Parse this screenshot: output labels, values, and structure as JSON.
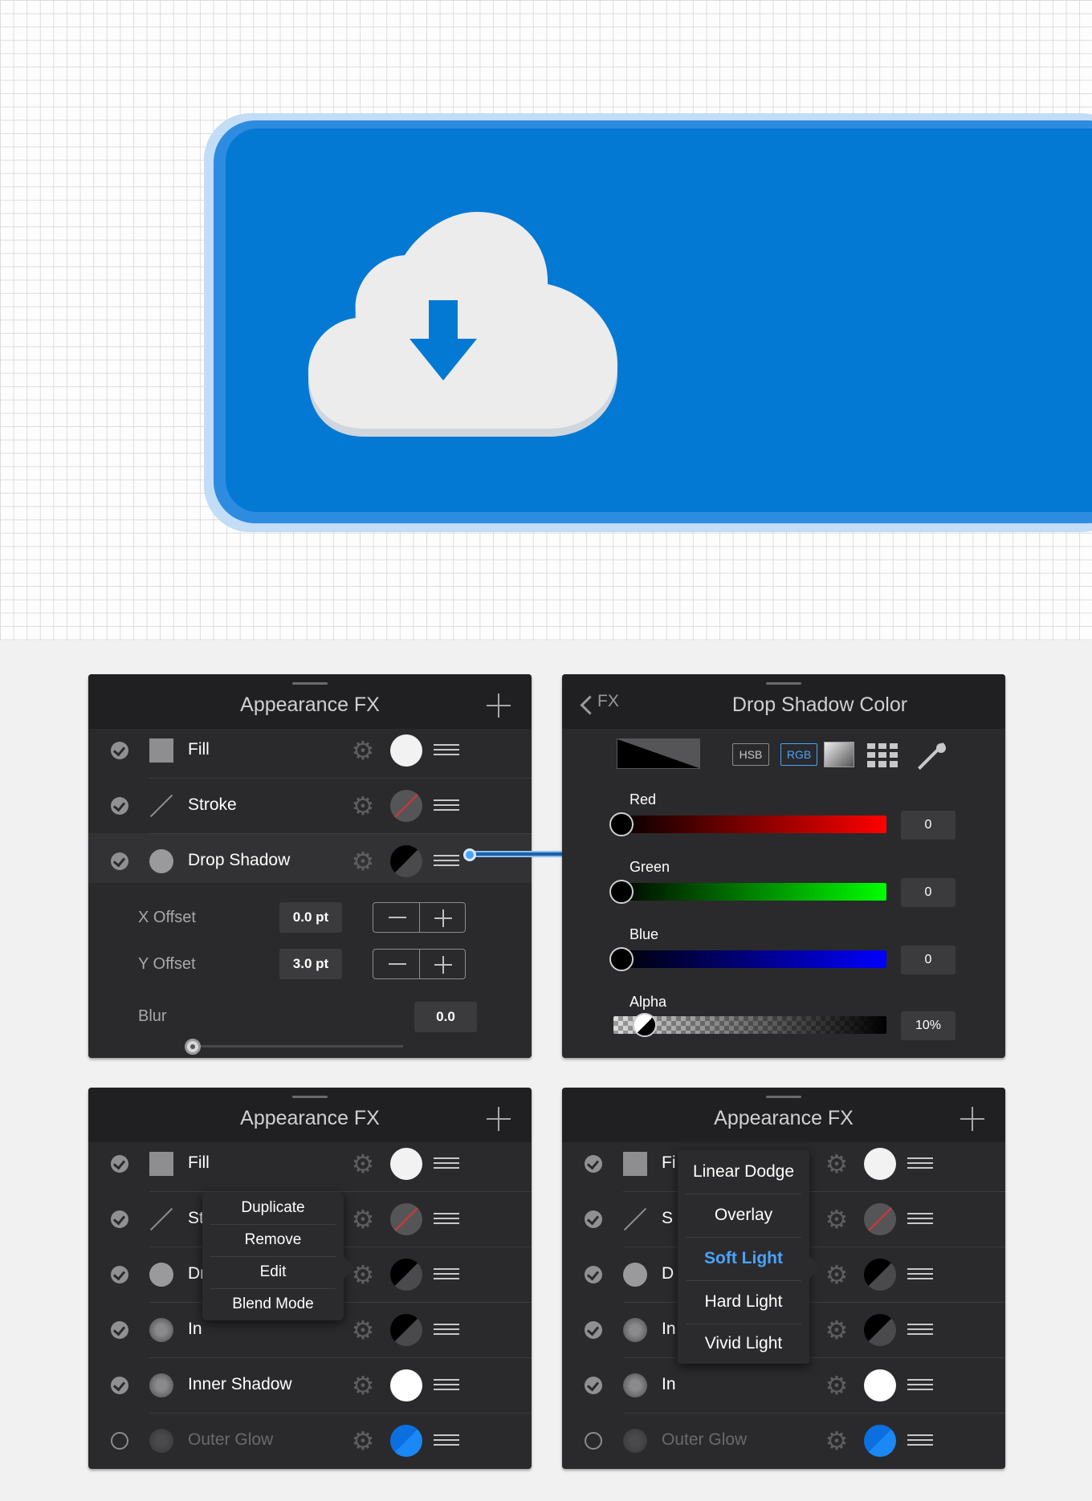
{
  "canvas": {
    "button_color": "#0479d4",
    "icon": "cloud-download-icon"
  },
  "fx_panel_1": {
    "title": "Appearance FX",
    "rows": [
      {
        "label": "Fill"
      },
      {
        "label": "Stroke"
      },
      {
        "label": "Drop Shadow"
      }
    ],
    "props": {
      "x_offset_label": "X Offset",
      "x_offset_value": "0.0 pt",
      "y_offset_label": "Y Offset",
      "y_offset_value": "3.0 pt",
      "blur_label": "Blur",
      "blur_value": "0.0"
    }
  },
  "color_panel": {
    "back_label": "FX",
    "title": "Drop Shadow Color",
    "hsb": "HSB",
    "rgb": "RGB",
    "red_label": "Red",
    "red_value": "0",
    "green_label": "Green",
    "green_value": "0",
    "blue_label": "Blue",
    "blue_value": "0",
    "alpha_label": "Alpha",
    "alpha_value": "10%"
  },
  "fx_panel_2": {
    "title": "Appearance FX",
    "rows": [
      {
        "label": "Fill"
      },
      {
        "label": "St"
      },
      {
        "label": "Dr"
      },
      {
        "label": "In"
      },
      {
        "label": "Inner Shadow"
      },
      {
        "label": "Outer Glow"
      }
    ],
    "menu": [
      "Duplicate",
      "Remove",
      "Edit",
      "Blend Mode"
    ]
  },
  "fx_panel_3": {
    "title": "Appearance FX",
    "rows": [
      {
        "label": "Fi"
      },
      {
        "label": "S"
      },
      {
        "label": "D"
      },
      {
        "label": "In"
      },
      {
        "label": "In"
      },
      {
        "label": "Outer Glow"
      }
    ],
    "menu": [
      "Linear Dodge",
      "Overlay",
      "Soft Light",
      "Hard Light",
      "Vivid Light"
    ],
    "menu_selected": "Soft Light"
  }
}
